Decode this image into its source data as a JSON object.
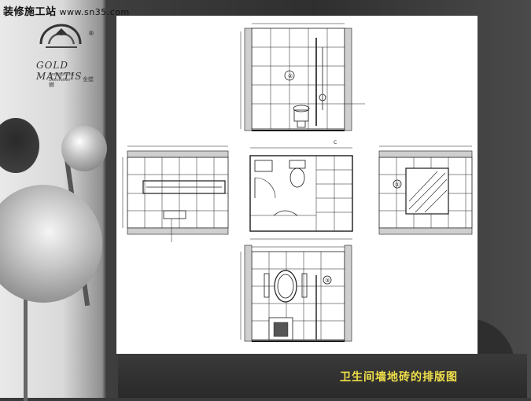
{
  "watermark": {
    "site": "装修施工站",
    "url": "www.sn35.com"
  },
  "logo": {
    "brand": "GOLD MANTIS",
    "line1": "Construction",
    "line2": "Decoration",
    "cn": "金螳螂",
    "reg": "®"
  },
  "drawing": {
    "plan_label": "C",
    "elevation_marks": [
      "②",
      "①",
      "③",
      "④"
    ]
  },
  "caption": "卫生间墙地砖的排版图",
  "colors": {
    "caption": "#f2e04a",
    "sheet": "#ffffff",
    "line": "#1a1a1a"
  }
}
